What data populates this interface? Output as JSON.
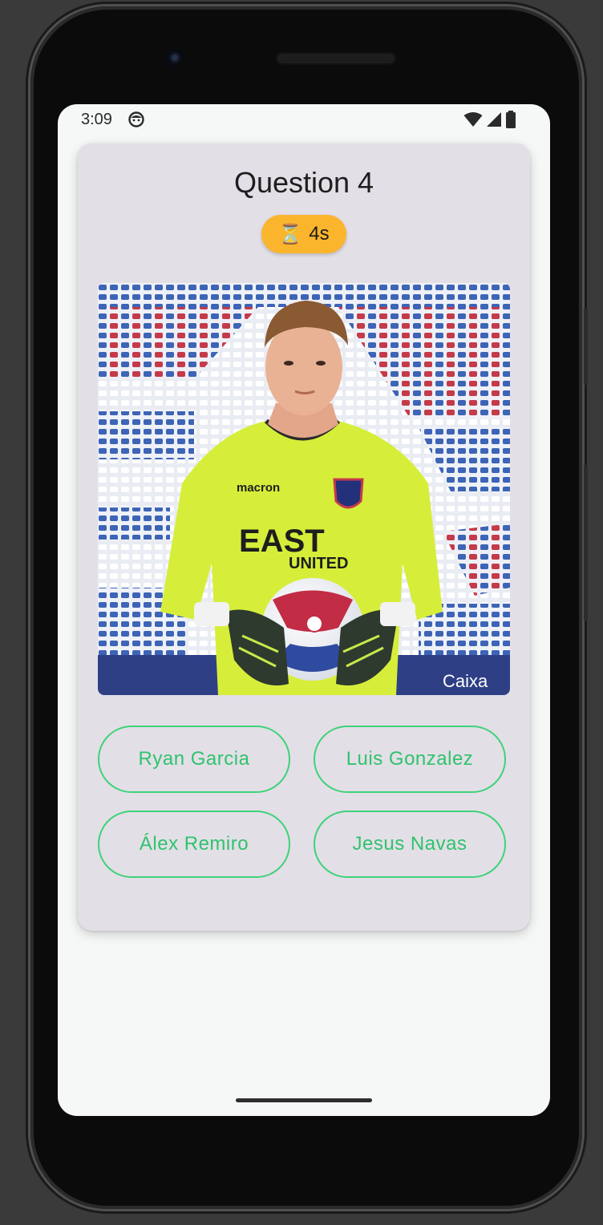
{
  "status_bar": {
    "time": "3:09",
    "app_icon": "android-face-icon",
    "wifi_icon": "wifi-icon",
    "signal_icon": "cell-signal-icon",
    "battery_icon": "battery-icon"
  },
  "quiz": {
    "question_title": "Question 4",
    "timer": {
      "icon": "hourglass-icon",
      "icon_glyph": "⏳",
      "label": "4s"
    },
    "image": {
      "kit_sponsor": "macron",
      "shirt_sponsor_line1": "EAST",
      "shirt_sponsor_line2": "UNITED",
      "ad_board": "Caixa"
    },
    "answers": [
      "Ryan Garcia",
      "Luis Gonzalez",
      "Álex Remiro",
      "Jesus Navas"
    ]
  },
  "colors": {
    "card_background": "#e3dfe6",
    "accent_green": "#3ed27a",
    "timer_badge": "#fbb52c",
    "screen_background": "#f6f8f8"
  }
}
